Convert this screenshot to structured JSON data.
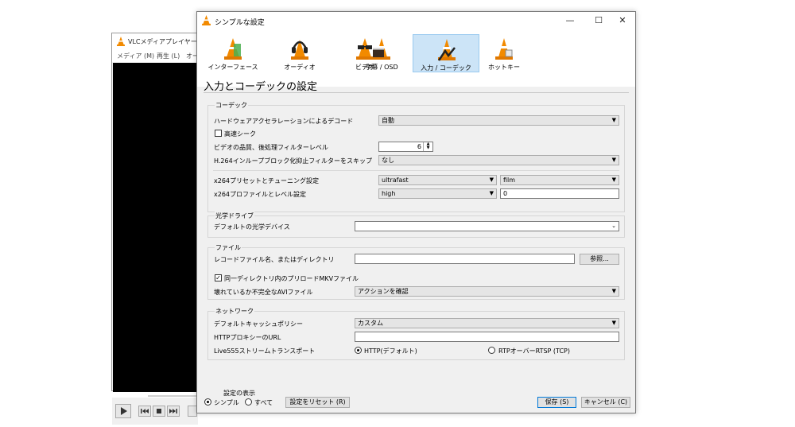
{
  "vlc": {
    "title": "VLCメディアプレイヤー",
    "menu": [
      "メディア (M)",
      "再生 (L)",
      "オー"
    ],
    "time": "--:--"
  },
  "dialog": {
    "title": "シンプルな設定",
    "controls": {
      "minimize": "—",
      "maximize": "☐",
      "close": "✕"
    },
    "tabs": [
      {
        "label": "インターフェース",
        "icon": "interface-cone-icon",
        "selected": false
      },
      {
        "label": "オーディオ",
        "icon": "audio-headphones-icon",
        "selected": false
      },
      {
        "label": "ビデオ",
        "icon": "video-glasses-icon",
        "selected": false
      },
      {
        "label": "字幕 / OSD",
        "icon": "subtitles-clapper-icon",
        "selected": false
      },
      {
        "label": "入力 / コーデック",
        "icon": "input-codec-icon",
        "selected": true
      },
      {
        "label": "ホットキー",
        "icon": "hotkeys-icon",
        "selected": false
      }
    ],
    "page_title": "入力とコーデックの設定",
    "codec": {
      "group": "コーデック",
      "hw_label": "ハードウェアアクセラレーションによるデコード",
      "hw_value": "自動",
      "fast_seek": "高速シーク",
      "fast_seek_checked": false,
      "pp_label": "ビデオの品質、後処理フィルターレベル",
      "pp_value": "6",
      "h264_label": "H.264インループブロック化抑止フィルターをスキップ",
      "h264_value": "なし",
      "x264_preset_label": "x264プリセットとチューニング設定",
      "x264_preset": "ultrafast",
      "x264_tune": "film",
      "x264_profile_label": "x264プロファイルとレベル設定",
      "x264_profile": "high",
      "x264_level": "0"
    },
    "disc": {
      "group": "光学ドライブ",
      "device_label": "デフォルトの光学デバイス",
      "device_value": ""
    },
    "files": {
      "group": "ファイル",
      "record_label": "レコードファイル名、またはディレクトリ",
      "record_value": "",
      "browse": "参照...",
      "preload": "同一ディレクトリ内のプリロードMKVファイル",
      "preload_checked": true,
      "avi_label": "壊れているか不完全なAVIファイル",
      "avi_value": "アクションを確認"
    },
    "network": {
      "group": "ネットワーク",
      "cache_label": "デフォルトキャッシュポリシー",
      "cache_value": "カスタム",
      "proxy_label": "HTTPプロキシーのURL",
      "proxy_value": "",
      "transport_label": "Live555ストリームトランスポート",
      "http_option": "HTTP(デフォルト)",
      "rtp_option": "RTPオーバーRTSP (TCP)",
      "selected": "http"
    },
    "footer": {
      "show_label": "設定の表示",
      "simple": "シンプル",
      "all": "すべて",
      "simple_selected": true,
      "reset": "設定をリセット (R)",
      "save": "保存 (S)",
      "cancel": "キャンセル (C)"
    }
  }
}
